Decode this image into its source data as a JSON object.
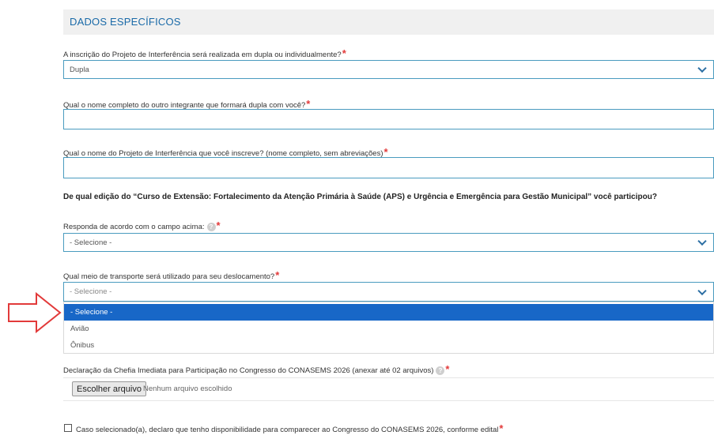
{
  "section": {
    "title": "DADOS ESPECÍFICOS"
  },
  "fields": {
    "inscricao": {
      "label": "A inscrição do Projeto de Interferência será realizada em dupla ou individualmente?",
      "value": "Dupla"
    },
    "nome_integrante": {
      "label": "Qual o nome completo do outro integrante que formará dupla com você?",
      "value": ""
    },
    "nome_projeto": {
      "label": "Qual o nome do Projeto de Interferência que você inscreve? (nome completo, sem abreviações)",
      "value": ""
    },
    "edicao_heading": "De qual edição do “Curso de Extensão: Fortalecimento da Atenção Primária à Saúde (APS) e Urgência e Emergência para Gestão Municipal” você participou?",
    "responda": {
      "label": "Responda de acordo com o campo acima:",
      "value": "- Selecione -"
    },
    "transporte": {
      "label": "Qual meio de transporte será utilizado para seu deslocamento?",
      "value": "- Selecione -",
      "options": [
        "- Selecione -",
        "Avião",
        "Ônibus"
      ]
    },
    "declaracao": {
      "label": "Declaração da Chefia Imediata para Participação no Congresso do CONASEMS 2026 (anexar até 02 arquivos)",
      "button": "Escolher arquivo",
      "status": "Nenhum arquivo escolhido"
    },
    "disponibilidade": {
      "label": "Caso selecionado(a), declaro que tenho disponibilidade para comparecer ao Congresso do CONASEMS 2026, conforme edital"
    }
  },
  "required_mark": "*",
  "help_icon": "?",
  "colors": {
    "accent": "#1a6aa8",
    "border": "#4a9bbf",
    "selected": "#1867c7",
    "required": "#e23a3a",
    "arrow": "#e23a3a"
  }
}
